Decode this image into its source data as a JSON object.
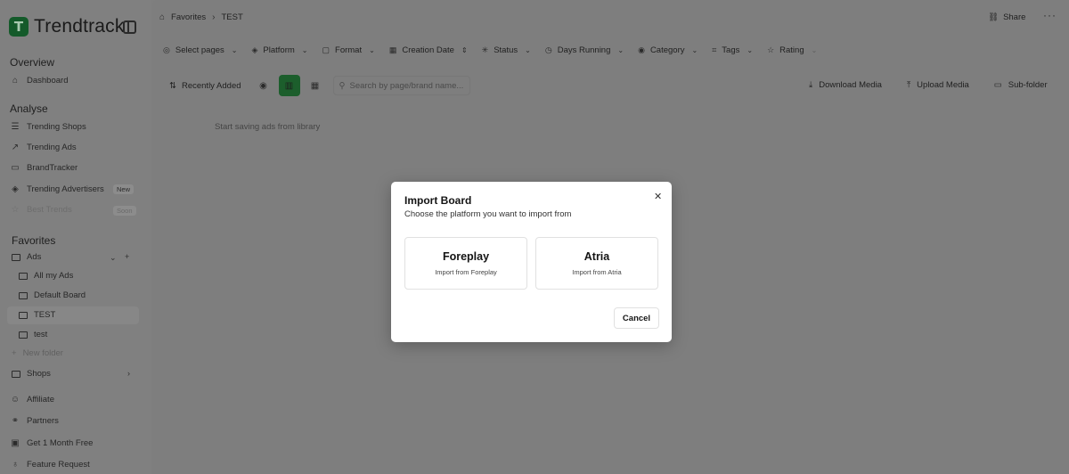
{
  "sidebar": {
    "logo_letter": "T",
    "logo_text": "Trendtrack",
    "sections": {
      "overview": "Overview",
      "analyse": "Analyse",
      "favorites": "Favorites"
    },
    "dashboard": "Dashboard",
    "trending_shops": "Trending Shops",
    "trending_ads": "Trending Ads",
    "brandtracker": "BrandTracker",
    "trending_advertisers": "Trending Advertisers",
    "new_badge": "New",
    "best_trends": "Best Trends",
    "soon_badge": "Soon",
    "ads": "Ads",
    "all_my_ads": "All my Ads",
    "default_board": "Default Board",
    "test_upper": "TEST",
    "test_lower": "test",
    "new_folder": "New folder",
    "shops": "Shops",
    "affiliate": "Affiliate",
    "partners": "Partners",
    "free_month": "Get 1 Month Free",
    "feature_request": "Feature Request"
  },
  "header": {
    "breadcrumb_root": "Favorites",
    "breadcrumb_current": "TEST",
    "share": "Share"
  },
  "filters": {
    "select_pages": "Select pages",
    "platform": "Platform",
    "format": "Format",
    "creation_date": "Creation Date",
    "status": "Status",
    "days_running": "Days Running",
    "category": "Category",
    "tags": "Tags",
    "rating": "Rating"
  },
  "toolbar": {
    "sort": "Recently Added",
    "search_placeholder": "Search by page/brand name...",
    "download_media": "Download Media",
    "upload_media": "Upload Media",
    "sub_folder": "Sub-folder"
  },
  "empty_note": "Start saving ads from library",
  "modal": {
    "title": "Import Board",
    "subtitle": "Choose the platform you want to import from",
    "options": [
      {
        "name": "Foreplay",
        "desc": "Import from Foreplay"
      },
      {
        "name": "Atria",
        "desc": "Import from Atria"
      }
    ],
    "cancel": "Cancel"
  },
  "colors": {
    "accent_green": "#1c7a3a",
    "overlay": "#7f7f7f"
  }
}
